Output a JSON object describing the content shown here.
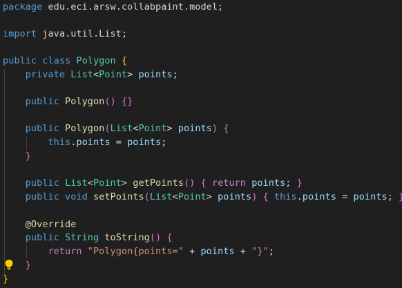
{
  "editor": {
    "language": "java",
    "theme_colors": {
      "background": "#1f1f1f",
      "keyword": "#569cd6",
      "control_keyword": "#c586c0",
      "type": "#4ec9b0",
      "function": "#dcdcaa",
      "variable": "#9cdcfe",
      "string": "#ce9178",
      "plain": "#d4d4d4",
      "bracket_level1": "#ffd700",
      "bracket_level2": "#da70d6",
      "bracket_level3": "#179fff"
    },
    "lightbulb_icon": "lightbulb-icon",
    "code": {
      "l1": {
        "t1": "package",
        "t2": " edu.eci.arsw.collabpaint.model;"
      },
      "l3": {
        "t1": "import",
        "t2": " java.util.List;"
      },
      "l5": {
        "t1": "public",
        "t2": " ",
        "t3": "class",
        "t4": " ",
        "t5": "Polygon",
        "t6": " ",
        "t7": "{"
      },
      "l6": {
        "t0": "    ",
        "t1": "private",
        "t2": " ",
        "t3": "List",
        "t4": "<",
        "t5": "Point",
        "t6": ">",
        "t7": " ",
        "t8": "points",
        "t9": ";"
      },
      "l8": {
        "t0": "    ",
        "t1": "public",
        "t2": " ",
        "t3": "Polygon",
        "t4": "()",
        "t5": " ",
        "t6": "{}"
      },
      "l10": {
        "t0": "    ",
        "t1": "public",
        "t2": " ",
        "t3": "Polygon",
        "t4": "(",
        "t5": "List",
        "t6": "<",
        "t7": "Point",
        "t8": ">",
        "t9": " ",
        "t10": "points",
        "t11": ")",
        "t12": " ",
        "t13": "{"
      },
      "l11": {
        "t0": "        ",
        "t1": "this",
        "t2": ".",
        "t3": "points",
        "t4": " = ",
        "t5": "points",
        "t6": ";"
      },
      "l12": {
        "t0": "    ",
        "t1": "}"
      },
      "l14": {
        "t0": "    ",
        "t1": "public",
        "t2": " ",
        "t3": "List",
        "t4": "<",
        "t5": "Point",
        "t6": ">",
        "t7": " ",
        "t8": "getPoints",
        "t9": "()",
        "t10": " ",
        "t11": "{",
        "t12": " ",
        "t13": "return",
        "t14": " ",
        "t15": "points",
        "t16": "; ",
        "t17": "}"
      },
      "l15": {
        "t0": "    ",
        "t1": "public",
        "t2": " ",
        "t3": "void",
        "t4": " ",
        "t5": "setPoints",
        "t6": "(",
        "t7": "List",
        "t8": "<",
        "t9": "Point",
        "t10": ">",
        "t11": " ",
        "t12": "points",
        "t13": ")",
        "t14": " ",
        "t15": "{",
        "t16": " ",
        "t17": "this",
        "t18": ".",
        "t19": "points",
        "t20": " = ",
        "t21": "points",
        "t22": "; ",
        "t23": "}"
      },
      "l17": {
        "t0": "    ",
        "t1": "@Override"
      },
      "l18": {
        "t0": "    ",
        "t1": "public",
        "t2": " ",
        "t3": "String",
        "t4": " ",
        "t5": "toString",
        "t6": "()",
        "t7": " ",
        "t8": "{"
      },
      "l19": {
        "t0": "        ",
        "t1": "return",
        "t2": " ",
        "t3": "\"Polygon{points=\"",
        "t4": " + ",
        "t5": "points",
        "t6": " + ",
        "t7": "\"}\"",
        "t8": ";"
      },
      "l20": {
        "t0": "    ",
        "t1": "}"
      },
      "l21": {
        "t1": "}"
      }
    }
  }
}
